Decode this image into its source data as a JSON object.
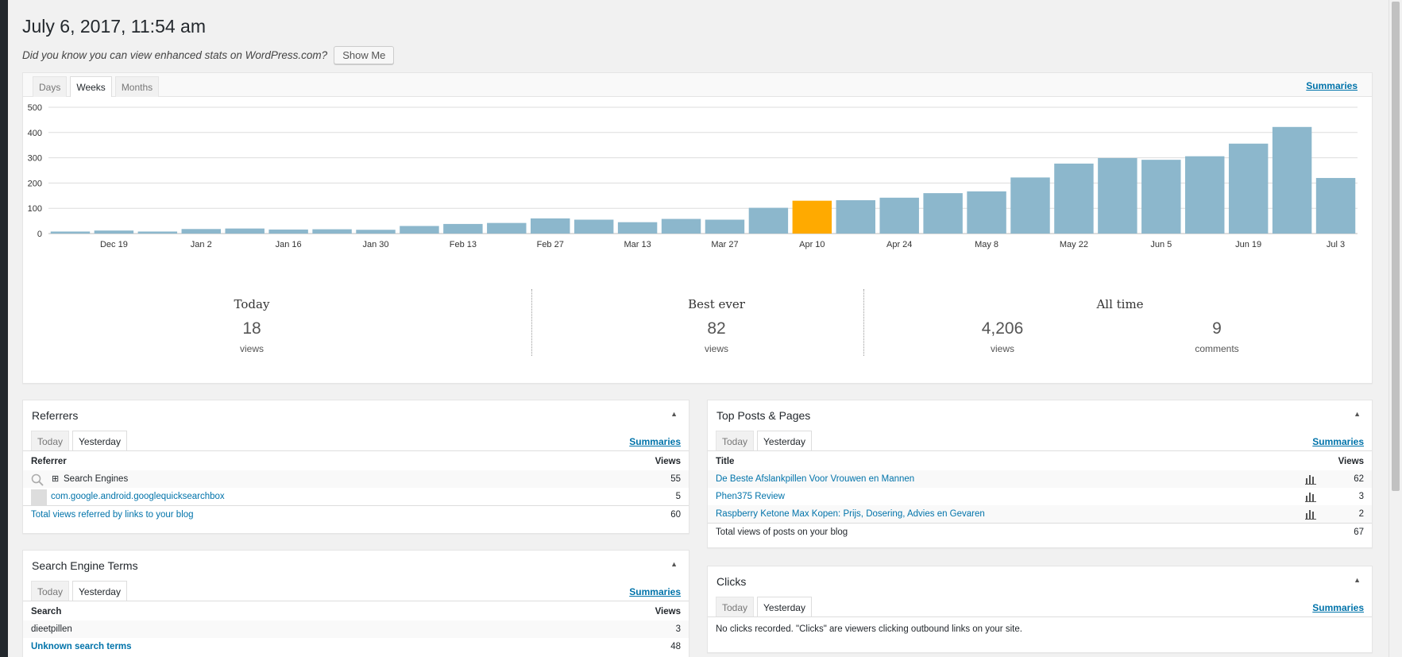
{
  "page": {
    "title": "July 6, 2017, 11:54 am",
    "promo_text": "Did you know you can view enhanced stats on WordPress.com?",
    "show_me_label": "Show Me"
  },
  "main_panel": {
    "tabs": [
      {
        "label": "Days",
        "active": false
      },
      {
        "label": "Weeks",
        "active": true
      },
      {
        "label": "Months",
        "active": false
      }
    ],
    "summaries_label": "Summaries"
  },
  "chart_data": {
    "type": "bar",
    "xlabel": "",
    "ylabel": "",
    "ylim": [
      0,
      500
    ],
    "yticks": [
      0,
      100,
      200,
      300,
      400,
      500
    ],
    "grid": true,
    "bar_color": "#8cb7cc",
    "highlight_color": "#ffaa00",
    "highlight_index": 17,
    "values": [
      8,
      12,
      8,
      18,
      20,
      16,
      17,
      15,
      30,
      38,
      42,
      60,
      55,
      45,
      58,
      55,
      102,
      130,
      132,
      142,
      160,
      167,
      222,
      277,
      299,
      292,
      306,
      356,
      422,
      220
    ],
    "tick_labels": [
      {
        "index": 1,
        "label": "Dec 19"
      },
      {
        "index": 3,
        "label": "Jan 2"
      },
      {
        "index": 5,
        "label": "Jan 16"
      },
      {
        "index": 7,
        "label": "Jan 30"
      },
      {
        "index": 9,
        "label": "Feb 13"
      },
      {
        "index": 11,
        "label": "Feb 27"
      },
      {
        "index": 13,
        "label": "Mar 13"
      },
      {
        "index": 15,
        "label": "Mar 27"
      },
      {
        "index": 17,
        "label": "Apr 10"
      },
      {
        "index": 19,
        "label": "Apr 24"
      },
      {
        "index": 21,
        "label": "May 8"
      },
      {
        "index": 23,
        "label": "May 22"
      },
      {
        "index": 25,
        "label": "Jun 5"
      },
      {
        "index": 27,
        "label": "Jun 19"
      },
      {
        "index": 29,
        "label": "Jul 3"
      }
    ]
  },
  "stats": {
    "today": {
      "label": "Today",
      "value": "18",
      "unit": "views"
    },
    "best_ever": {
      "label": "Best ever",
      "value": "82",
      "unit": "views"
    },
    "all_time": {
      "label": "All time",
      "views": "4,206",
      "views_unit": "views",
      "comments": "9",
      "comments_unit": "comments"
    }
  },
  "referrers": {
    "title": "Referrers",
    "tabs": [
      "Today",
      "Yesterday"
    ],
    "summaries_label": "Summaries",
    "col_left": "Referrer",
    "col_right": "Views",
    "rows": [
      {
        "label": "Search Engines",
        "views": "55"
      },
      {
        "label": "com.google.android.googlequicksearchbox",
        "views": "5"
      }
    ],
    "total_label": "Total views referred by links to your blog",
    "total_value": "60",
    "expand_glyph": "⊞"
  },
  "search_terms": {
    "title": "Search Engine Terms",
    "tabs": [
      "Today",
      "Yesterday"
    ],
    "summaries_label": "Summaries",
    "col_left": "Search",
    "col_right": "Views",
    "rows": [
      {
        "label": "dieetpillen",
        "views": "3"
      },
      {
        "label": "Unknown search terms",
        "views": "48"
      }
    ]
  },
  "top_posts": {
    "title": "Top Posts & Pages",
    "tabs": [
      "Today",
      "Yesterday"
    ],
    "summaries_label": "Summaries",
    "col_left": "Title",
    "col_right": "Views",
    "rows": [
      {
        "label": "De Beste Afslankpillen Voor Vrouwen en Mannen",
        "views": "62"
      },
      {
        "label": "Phen375 Review",
        "views": "3"
      },
      {
        "label": "Raspberry Ketone Max Kopen: Prijs, Dosering, Advies en Gevaren",
        "views": "2"
      }
    ],
    "total_label": "Total views of posts on your blog",
    "total_value": "67"
  },
  "clicks": {
    "title": "Clicks",
    "tabs": [
      "Today",
      "Yesterday"
    ],
    "summaries_label": "Summaries",
    "empty_bold": "No clicks recorded.",
    "empty_text": "\"Clicks\" are viewers clicking outbound links on your site."
  },
  "toggle_glyph": "▲"
}
